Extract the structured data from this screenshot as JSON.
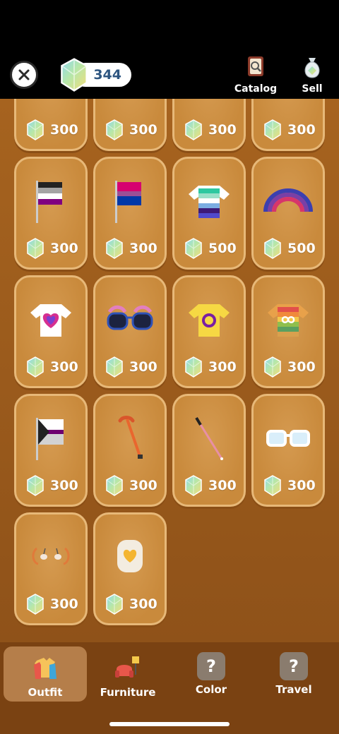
{
  "header": {
    "gem_count": "344",
    "catalog_label": "Catalog",
    "sell_label": "Sell"
  },
  "grid": {
    "row0": [
      "300",
      "300",
      "300",
      "300"
    ],
    "row1": [
      "300",
      "300",
      "500",
      "500"
    ],
    "row2": [
      "300",
      "300",
      "300",
      "300"
    ],
    "row3": [
      "300",
      "300",
      "300",
      "300"
    ],
    "row4": [
      "300",
      "300"
    ]
  },
  "nav": {
    "tabs": [
      {
        "label": "Outfit"
      },
      {
        "label": "Furniture"
      },
      {
        "label": "Color"
      },
      {
        "label": "Travel"
      }
    ],
    "locked_glyph": "?"
  }
}
